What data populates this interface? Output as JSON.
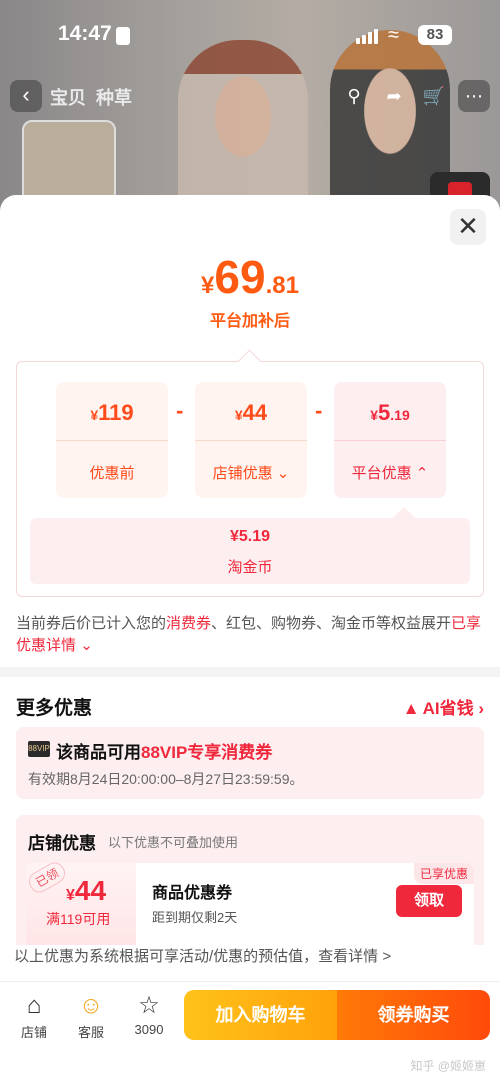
{
  "status_bar": {
    "time": "14:47",
    "battery": "83"
  },
  "nav": {
    "tabs": [
      "宝贝",
      "种草"
    ]
  },
  "sheet": {
    "price": {
      "symbol": "¥",
      "integer": "69",
      "decimal": ".81",
      "label": "平台加补后"
    },
    "breakdown": {
      "original": {
        "symbol": "¥",
        "amount": "119",
        "label": "优惠前"
      },
      "store_discount": {
        "symbol": "¥",
        "amount": "44",
        "label": "店铺优惠"
      },
      "platform_discount": {
        "symbol": "¥",
        "integer": "5",
        "decimal": ".19",
        "label": "平台优惠"
      },
      "minus_sign": "-",
      "coin": {
        "amount": "¥5.19",
        "label": "淘金币"
      }
    },
    "note": {
      "part1": "当前券后价已计入您的",
      "highlight1": "消费券",
      "part2": "、红包、购物券、淘金币等权益展开",
      "highlight2": "已享优惠详情"
    },
    "more": {
      "title": "更多优惠",
      "ai_label": "AI省钱",
      "vip": {
        "badge": "88VIP",
        "title_prefix": "该商品可用",
        "title_highlight": "88VIP专享消费券",
        "validity": "有效期8月24日20:00:00–8月27日23:59:59。"
      },
      "shop": {
        "title": "店铺优惠",
        "subtitle": "以下优惠不可叠加使用",
        "coupon": {
          "stamp": "已领",
          "symbol": "¥",
          "amount": "44",
          "condition": "满119可用",
          "name": "商品优惠券",
          "expiry": "距到期仅剩2天",
          "enjoyed": "已享优惠",
          "claim": "领取"
        }
      }
    },
    "estimate_note": "以上优惠为系统根据可享活动/优惠的预估值，查看详情 >"
  },
  "bottom_bar": {
    "store": "店铺",
    "service": "客服",
    "favorites": "3090",
    "add_to_cart": "加入购物车",
    "buy": "领券购买"
  },
  "watermark": "知乎 @姬姬崽"
}
